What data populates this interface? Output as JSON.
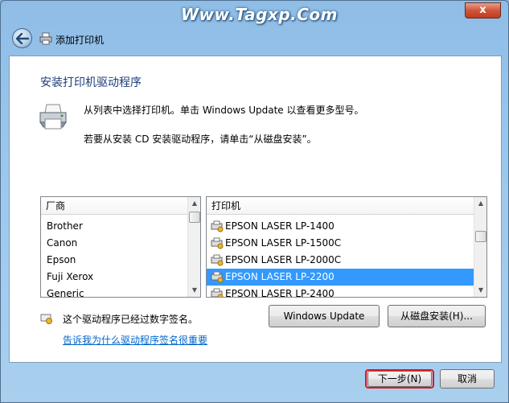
{
  "watermark": "Www.Tagxp.Com",
  "window": {
    "close_label": "x"
  },
  "nav": {
    "title": "添加打印机"
  },
  "page": {
    "heading": "安装打印机驱动程序",
    "desc_line1": "从列表中选择打印机。单击 Windows Update 以查看更多型号。",
    "desc_line2": "若要从安装 CD 安装驱动程序，请单击“从磁盘安装”。"
  },
  "manufacturers": {
    "header": "厂商",
    "items": [
      "Brother",
      "Canon",
      "Epson",
      "Fuji Xerox",
      "Generic"
    ]
  },
  "printers": {
    "header": "打印机",
    "items": [
      "EPSON LASER LP-1400",
      "EPSON LASER LP-1500C",
      "EPSON LASER LP-2000C",
      "EPSON LASER LP-2200",
      "EPSON LASER LP-2400"
    ],
    "selected_index": 3
  },
  "buttons": {
    "windows_update": "Windows Update",
    "from_disk": "从磁盘安装(H)...",
    "next": "下一步(N)",
    "cancel": "取消"
  },
  "signature": {
    "text": "这个驱动程序已经过数字签名。",
    "link": "告诉我为什么驱动程序签名很重要"
  },
  "colors": {
    "selection": "#3399ff",
    "heading": "#1c3d7a",
    "link": "#0066cc",
    "highlight_outline": "#e0141e"
  }
}
